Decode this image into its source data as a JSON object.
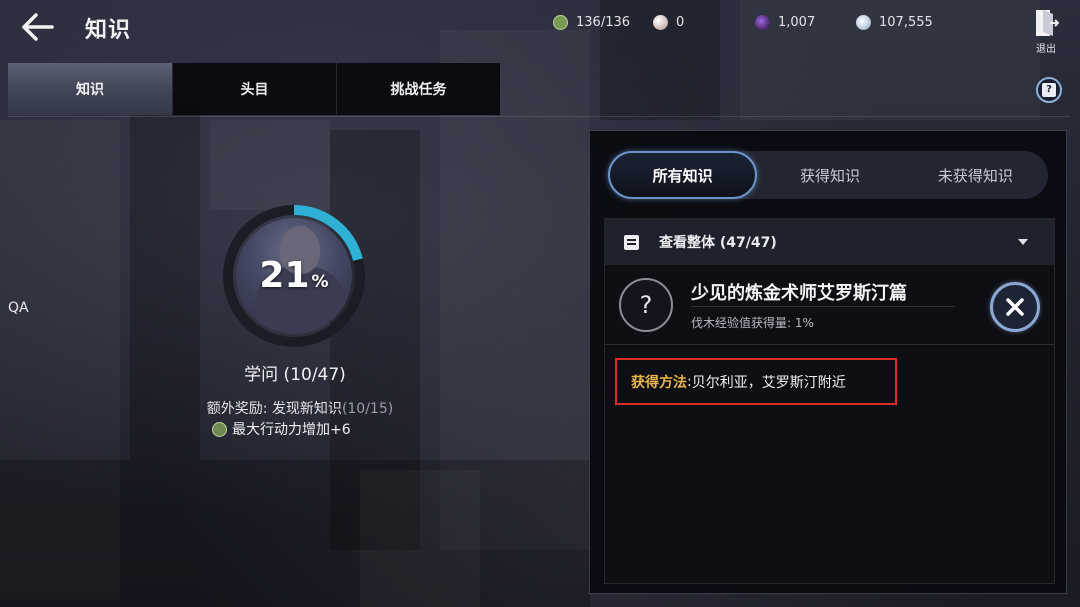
{
  "header": {
    "title": "知识",
    "exit_label": "退出"
  },
  "resources": [
    {
      "icon": "energy-icon",
      "value": "136/136",
      "color": "#7a9a56"
    },
    {
      "icon": "pearl-icon",
      "value": "0",
      "color": "#d8c8c4"
    },
    {
      "icon": "gem-icon",
      "value": "1,007",
      "color": "#5b2f8f"
    },
    {
      "icon": "silver-coin-icon",
      "value": "107,555",
      "color": "#b9c9de"
    }
  ],
  "tabs": [
    {
      "label": "知识",
      "active": true
    },
    {
      "label": "头目",
      "active": false
    },
    {
      "label": "挑战任务",
      "active": false
    }
  ],
  "side_label": "QA",
  "progress": {
    "percent_value": "21",
    "percent_sign": "%",
    "fraction": 0.21,
    "title": "学问 (10/47)",
    "bonus_label": "额外奖励: 发现新知识",
    "bonus_progress": "(10/15)",
    "bonus_reward": "最大行动力增加+6",
    "ring_color": "#2fb1d6"
  },
  "panel": {
    "filters": [
      {
        "label": "所有知识",
        "active": true
      },
      {
        "label": "获得知识",
        "active": false
      },
      {
        "label": "未获得知识",
        "active": false
      }
    ],
    "group": {
      "label": "查看整体 (47/47)"
    },
    "entry": {
      "icon_text": "?",
      "name": "少见的炼金术师艾罗斯汀篇",
      "subtitle": "伐木经验值获得量: 1%"
    },
    "method": {
      "key": "获得方法",
      "sep": " : ",
      "value": "贝尔利亚，艾罗斯汀附近"
    }
  },
  "colors": {
    "accent_blue": "#6b93c8",
    "highlight_red": "#e02a2a",
    "method_key": "#e8b54a"
  }
}
